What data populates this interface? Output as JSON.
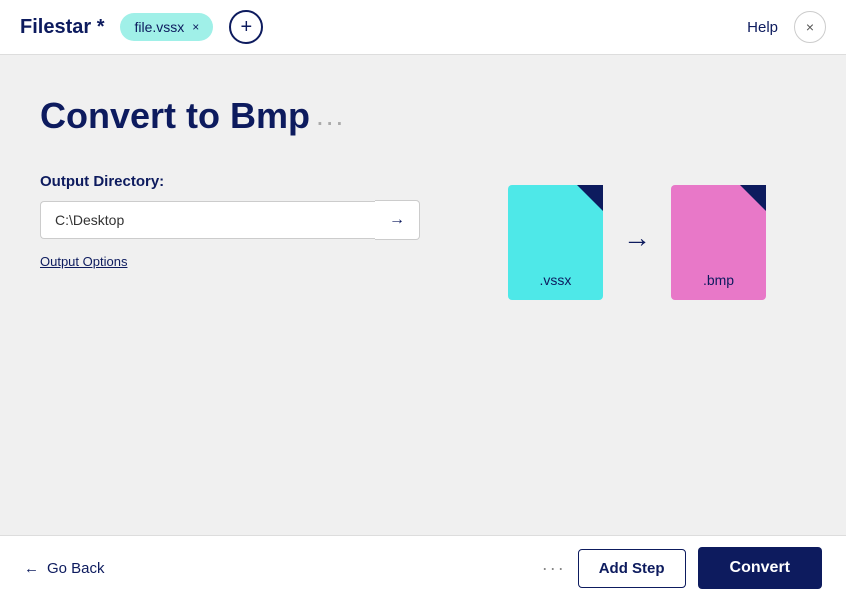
{
  "header": {
    "app_title": "Filestar *",
    "tab_label": "file.vssx",
    "tab_close": "×",
    "add_tab_icon": "+",
    "help_label": "Help",
    "close_icon": "×"
  },
  "main": {
    "page_title": "Convert to Bmp",
    "title_dots": "...",
    "output_label": "Output Directory:",
    "output_dir_value": "C:\\Desktop",
    "output_dir_arrow": "→",
    "output_options_label": "Output Options"
  },
  "conversion_visual": {
    "source_label": ".vssx",
    "target_label": ".bmp",
    "arrow": "→"
  },
  "footer": {
    "go_back_arrow": "←",
    "go_back_label": "Go Back",
    "dots": "···",
    "add_step_label": "Add Step",
    "convert_label": "Convert"
  }
}
